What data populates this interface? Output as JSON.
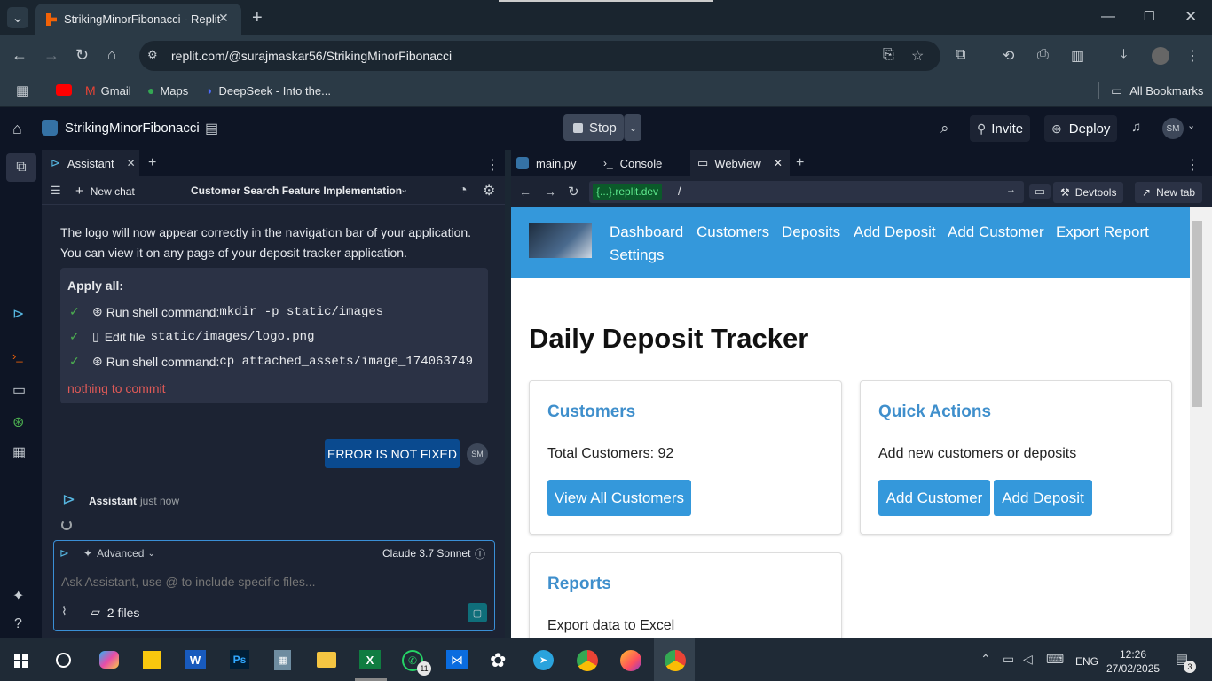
{
  "browser": {
    "tab_title": "StrikingMinorFibonacci - Replit",
    "url": "replit.com/@surajmaskar56/StrikingMinorFibonacci",
    "bookmarks": [
      "Gmail",
      "Maps",
      "DeepSeek - Into the..."
    ],
    "all_bookmarks": "All Bookmarks"
  },
  "replit": {
    "project_name": "StrikingMinorFibonacci",
    "stop_label": "Stop",
    "invite_label": "Invite",
    "deploy_label": "Deploy",
    "avatar": "SM"
  },
  "assistant": {
    "tab_label": "Assistant",
    "new_chat": "New chat",
    "chat_title": "Customer Search Feature Implementation",
    "message_text": "The logo will now appear correctly in the navigation bar of your application. You can view it on any page of your deposit tracker application.",
    "apply_all": "Apply all:",
    "actions": [
      {
        "label": "Run shell command:",
        "code": "mkdir -p static/images"
      },
      {
        "label": "Edit file",
        "code": "static/images/logo.png"
      },
      {
        "label": "Run shell command:",
        "code": "cp attached_assets/image_174063749"
      }
    ],
    "commit_status": "nothing to commit",
    "user_message": "ERROR IS NOT FIXED",
    "user_avatar": "SM",
    "reply_author": "Assistant",
    "reply_time": "just now",
    "advanced_label": "Advanced",
    "model_label": "Claude 3.7 Sonnet",
    "input_placeholder": "Ask Assistant, use @ to include specific files...",
    "files_label": "2 files"
  },
  "editor_tabs": {
    "tabs": [
      "main.py",
      "Console",
      "Webview"
    ],
    "webview_domain": "{...}.replit.dev",
    "webview_path": "/",
    "devtools": "Devtools",
    "new_tab": "New tab"
  },
  "webview": {
    "nav_links": [
      "Dashboard",
      "Customers",
      "Deposits",
      "Add Deposit",
      "Add Customer",
      "Export Report",
      "Settings"
    ],
    "page_title": "Daily Deposit Tracker",
    "customers_card": {
      "title": "Customers",
      "text": "Total Customers: 92",
      "button": "View All Customers"
    },
    "quick_card": {
      "title": "Quick Actions",
      "text": "Add new customers or deposits",
      "buttons": [
        "Add Customer",
        "Add Deposit"
      ]
    },
    "reports_card": {
      "title": "Reports",
      "text": "Export data to Excel"
    }
  },
  "taskbar": {
    "lang": "ENG",
    "time": "12:26",
    "date": "27/02/2025",
    "whatsapp_badge": "11",
    "notif_badge": "3"
  },
  "colors": {
    "accent": "#3498db",
    "replit_bg": "#0e1525",
    "panel_bg": "#1c2333",
    "error": "#e05a57"
  }
}
